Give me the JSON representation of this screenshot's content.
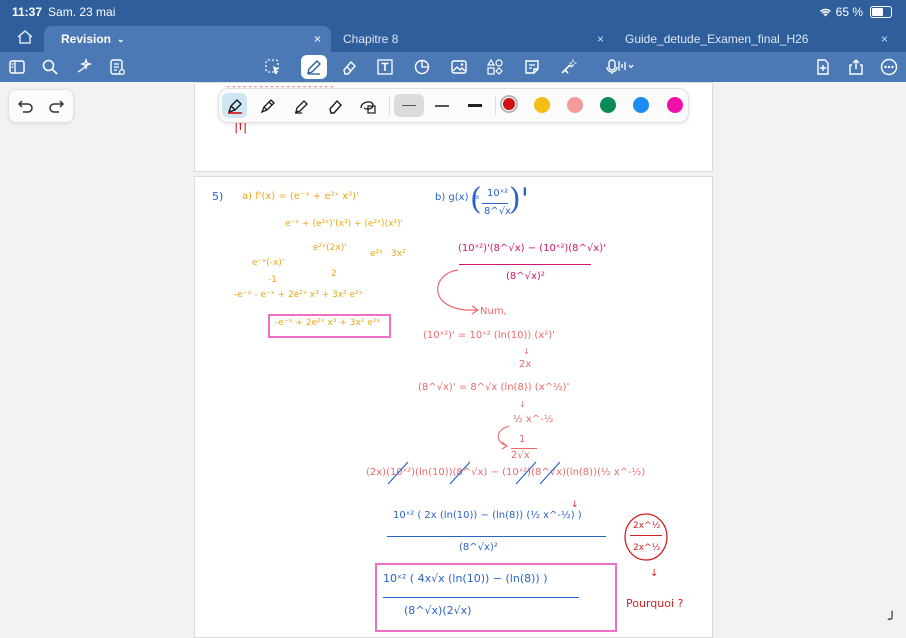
{
  "status": {
    "time": "11:37",
    "date": "Sam. 23 mai",
    "battery": "65 %",
    "battery_level": 0.65
  },
  "tabs": [
    {
      "label": "Revision",
      "active": true
    },
    {
      "label": "Chapitre 8",
      "active": false
    },
    {
      "label": "Guide_detude_Examen_final_H26",
      "active": false
    }
  ],
  "toolbar": {
    "center_tools": [
      "lasso",
      "pen",
      "eraser",
      "text",
      "shapes",
      "image",
      "elements",
      "sticky-note",
      "laser"
    ],
    "active": "pen"
  },
  "pen_toolbar": {
    "tools": [
      "fountain-pen",
      "ballpoint-pen",
      "highlighter",
      "eraser",
      "lasso"
    ],
    "active_tool": "fountain-pen",
    "colors": [
      "#d01010",
      "#f5be16",
      "#f59a9a",
      "#0a8a56",
      "#1b8cf0",
      "#f012a8"
    ],
    "selected_color": "#d01010"
  },
  "notes": {
    "top_fragment": "|f|",
    "q_number": "5)",
    "part_a": "a)  f'(x) = (e⁻ˣ + e²ˣ x³)'",
    "a_line1": "e⁻ˣ + (e²ˣ)'(x³) + (e²ˣ)(x³)'",
    "a_e2x2x": "e²ˣ(2x)'",
    "a_e2x": "e²ˣ",
    "a_3x2": "3x²",
    "a_emx": "e⁻ˣ(-x)'",
    "a_m1": "-1",
    "a_2": "2",
    "a_line_sum": "-e⁻ˣ   - e⁻ˣ + 2e²ˣ x³   + 3x² e²ˣ",
    "a_result": "-e⁻ˣ + 2e²ˣ x³ + 3x² e²ˣ",
    "part_b": "b)  g(x) =",
    "b_frac_num": "10ˣ²",
    "b_frac_den": "8^√x",
    "quot_num": "(10ˣ²)'(8^√x) − (10ˣ²)(8^√x)'",
    "quot_den": "(8^√x)²",
    "num_label": "Num,",
    "deriv1": "(10ˣ²)' = 10ˣ² (ln(10)) (x²)'",
    "deriv1_sub": "2x",
    "deriv2": "(8^√x)' = 8^√x (ln(8)) (x^½)'",
    "deriv2_sub": "½ x^-½",
    "deriv2_sub2_num": "1",
    "deriv2_sub2_den": "2√x",
    "expand_line": "(2x)(10ˣ²)(ln(10))(8^√x)  −  (10ˣ²)(8^√x)(ln(8))(½ x^-½)",
    "fact_num": "10ˣ² ( 2x (ln(10)) − (ln(8)) (½ x^-½) )",
    "fact_den": "(8^√x)²",
    "final_num": "10ˣ² ( 4x√x (ln(10)) − (ln(8)) )",
    "final_den": "(8^√x)(2√x)",
    "side_num": "2x^½",
    "side_den": "2x^½",
    "side_q": "Pourquoi ?"
  }
}
